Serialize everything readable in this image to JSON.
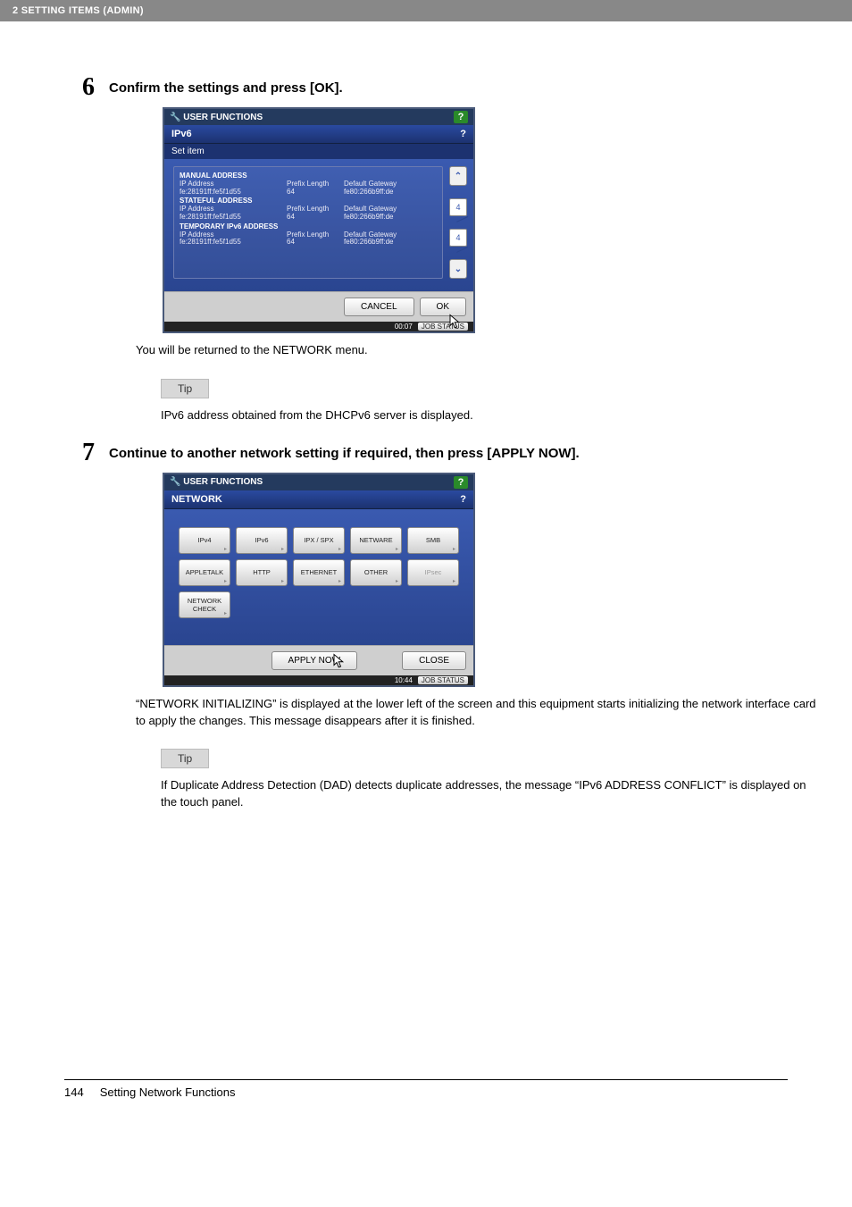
{
  "header": {
    "breadcrumb": "2 SETTING ITEMS (ADMIN)"
  },
  "steps": {
    "s6": {
      "num": "6",
      "title": "Confirm the settings and press [OK].",
      "after": "You will be returned to the NETWORK menu.",
      "tip_label": "Tip",
      "tip_body": "IPv6 address obtained from the DHCPv6 server is displayed."
    },
    "s7": {
      "num": "7",
      "title": "Continue to another network setting if required, then press [APPLY NOW].",
      "after": "“NETWORK INITIALIZING” is displayed at the lower left of the screen and this equipment starts initializing the network interface card to apply the changes. This message disappears after it is finished.",
      "tip_label": "Tip",
      "tip_body": "If Duplicate Address Detection (DAD) detects duplicate addresses, the message “IPv6 ADDRESS CONFLICT” is displayed on the touch panel."
    }
  },
  "shot1": {
    "window_title": "USER FUNCTIONS",
    "help": "?",
    "tab": "IPv6",
    "subtitle": "Set item",
    "scroll": {
      "up": "⌃",
      "down": "⌄",
      "page_upper": "4",
      "page_lower": "4"
    },
    "sections": [
      {
        "name": "MANUAL ADDRESS",
        "rows": [
          {
            "l": "IP Address",
            "m": "Prefix Length",
            "r": "Default Gateway"
          },
          {
            "l": "fe:28191ff:fe5f1d55",
            "m": "64",
            "r": "fe80:266b9ff:de"
          }
        ]
      },
      {
        "name": "STATEFUL ADDRESS",
        "rows": [
          {
            "l": "IP Address",
            "m": "Prefix Length",
            "r": "Default Gateway"
          },
          {
            "l": "fe:28191ff:fe5f1d55",
            "m": "64",
            "r": "fe80:266b9ff:de"
          }
        ]
      },
      {
        "name": "TEMPORARY IPv6 ADDRESS",
        "rows": [
          {
            "l": "IP Address",
            "m": "Prefix Length",
            "r": "Default Gateway"
          },
          {
            "l": "fe:28191ff:fe5f1d55",
            "m": "64",
            "r": "fe80:266b9ff:de"
          }
        ]
      }
    ],
    "buttons": {
      "cancel": "CANCEL",
      "ok": "OK"
    },
    "status": {
      "time": "00:07",
      "jobstatus": "JOB STATUS"
    }
  },
  "shot2": {
    "window_title": "USER FUNCTIONS",
    "help": "?",
    "tab": "NETWORK",
    "buttons_row1": [
      "IPv4",
      "IPv6",
      "IPX / SPX",
      "NETWARE",
      "SMB"
    ],
    "buttons_row2": [
      "APPLETALK",
      "HTTP",
      "ETHERNET",
      "OTHER",
      "IPsec"
    ],
    "buttons_row3": [
      "NETWORK CHECK"
    ],
    "apply": "APPLY NOW",
    "close": "CLOSE",
    "status": {
      "time": "10:44",
      "jobstatus": "JOB STATUS"
    }
  },
  "footer": {
    "page_num": "144",
    "page_title": "Setting Network Functions"
  }
}
